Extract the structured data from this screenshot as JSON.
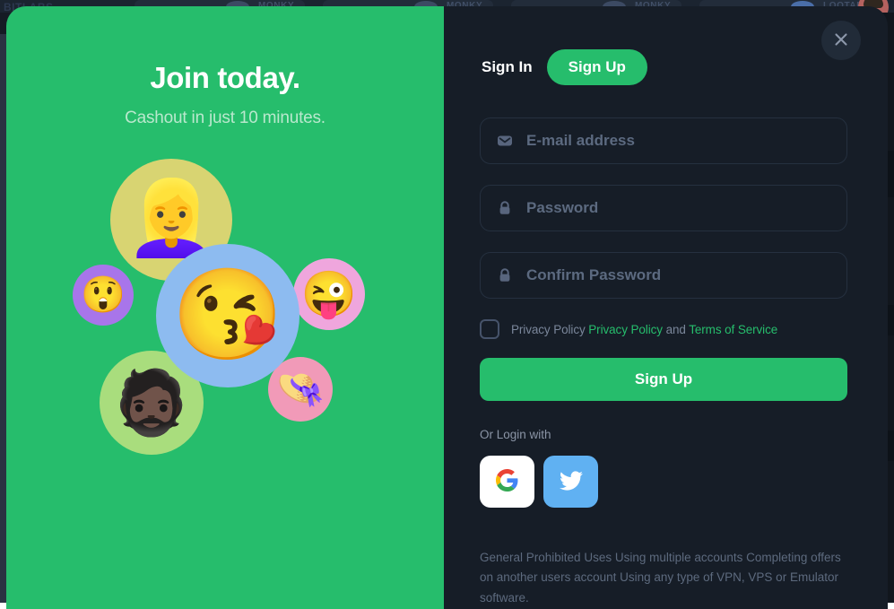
{
  "background": {
    "brand_text": "BITLABS",
    "cards": [
      {
        "label": "MONKY"
      },
      {
        "label": "MONKY"
      },
      {
        "label": "MONKY"
      },
      {
        "label": "LOOTABLY"
      }
    ]
  },
  "modal": {
    "close_label": "×",
    "promo": {
      "title": "Join today.",
      "subtitle": "Cashout in just 10 minutes.",
      "avatars": [
        {
          "name": "avatar-pink-hair-girl",
          "emoji": "👱‍♀️",
          "circle_color": "#d8d472"
        },
        {
          "name": "avatar-glasses-man",
          "emoji": "😲",
          "circle_color": "#a875ea"
        },
        {
          "name": "avatar-kiss-heart-girl",
          "emoji": "😘",
          "circle_color": "#8dbbf0"
        },
        {
          "name": "avatar-wink-tongue-girl",
          "emoji": "😜",
          "circle_color": "#efa6dd"
        },
        {
          "name": "avatar-bearded-man",
          "emoji": "🧔🏿",
          "circle_color": "#a9dd7d"
        },
        {
          "name": "avatar-hat-girl",
          "emoji": "👒",
          "circle_color": "#f19ab8"
        }
      ]
    },
    "tabs": {
      "sign_in": "Sign In",
      "sign_up": "Sign Up",
      "active": "Sign Up"
    },
    "form": {
      "email": {
        "placeholder": "E-mail address",
        "value": "",
        "icon": "envelope-icon"
      },
      "password": {
        "placeholder": "Password",
        "value": "",
        "icon": "lock-icon"
      },
      "confirm_password": {
        "placeholder": "Confirm Password",
        "value": "",
        "icon": "lock-icon"
      },
      "consent": {
        "checked": false,
        "prefix": "Privacy Policy",
        "privacy_link": "Privacy Policy",
        "conjunction": "and",
        "terms_link": "Terms of Service"
      },
      "submit_label": "Sign Up"
    },
    "social": {
      "label": "Or Login with",
      "providers": [
        {
          "name": "google",
          "letter": "G"
        },
        {
          "name": "twitter",
          "letter": ""
        }
      ]
    },
    "disclaimer": "General Prohibited Uses Using multiple accounts Completing offers on another users account Using any type of VPN, VPS or Emulator software."
  },
  "colors": {
    "brand_green": "#26bd6c",
    "panel_dark": "#161d27",
    "page_dark": "#151b24",
    "placeholder": "#5c6a80",
    "muted_text": "#5d6a7e",
    "google_blue": "#4285F4",
    "twitter_blue": "#60b1f2"
  }
}
